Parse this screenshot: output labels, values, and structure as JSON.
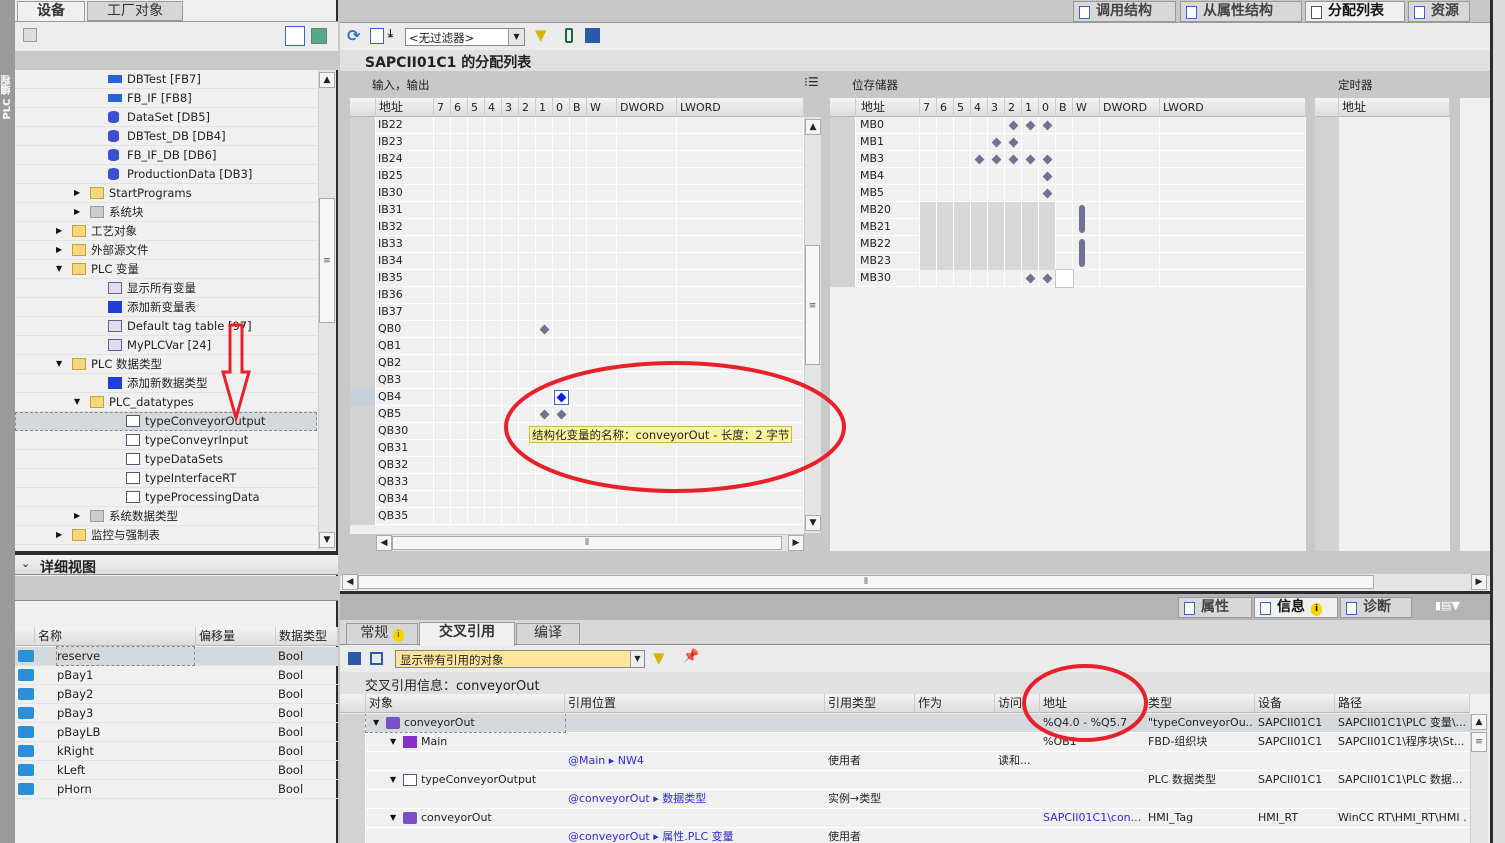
{
  "side_strip": "PLC 编程",
  "project_tree": {
    "tabs": [
      "设备",
      "工厂对象"
    ],
    "items": [
      {
        "label": "DBTest [FB7]",
        "level": 3,
        "icon": "fb-icon"
      },
      {
        "label": "FB_IF [FB8]",
        "level": 3,
        "icon": "fb-icon"
      },
      {
        "label": "DataSet [DB5]",
        "level": 3,
        "icon": "db-icon"
      },
      {
        "label": "DBTest_DB [DB4]",
        "level": 3,
        "icon": "db-icon"
      },
      {
        "label": "FB_IF_DB [DB6]",
        "level": 3,
        "icon": "db-icon"
      },
      {
        "label": "ProductionData [DB3]",
        "level": 3,
        "icon": "db-icon"
      },
      {
        "label": "StartPrograms",
        "level": 2,
        "icon": "folder-icon",
        "expand": "collapsed"
      },
      {
        "label": "系统块",
        "level": 2,
        "icon": "gray-folder-icon",
        "expand": "collapsed"
      },
      {
        "label": "工艺对象",
        "level": 1,
        "icon": "folder-icon",
        "expand": "collapsed"
      },
      {
        "label": "外部源文件",
        "level": 1,
        "icon": "folder-icon",
        "expand": "collapsed"
      },
      {
        "label": "PLC 变量",
        "level": 1,
        "icon": "folder-icon",
        "expand": "expanded"
      },
      {
        "label": "显示所有变量",
        "level": 3,
        "icon": "tag-table-icon"
      },
      {
        "label": "添加新变量表",
        "level": 3,
        "icon": "add-new-icon"
      },
      {
        "label": "Default tag table [97]",
        "level": 3,
        "icon": "tag-table-icon"
      },
      {
        "label": "MyPLCVar [24]",
        "level": 3,
        "icon": "tag-table-icon"
      },
      {
        "label": "PLC 数据类型",
        "level": 1,
        "icon": "folder-icon",
        "expand": "expanded"
      },
      {
        "label": "添加新数据类型",
        "level": 3,
        "icon": "add-new-icon"
      },
      {
        "label": "PLC_datatypes",
        "level": 2,
        "icon": "folder-icon",
        "expand": "expanded"
      },
      {
        "label": "typeConveyorOutput",
        "level": 4,
        "icon": "udt-icon",
        "selected": true
      },
      {
        "label": "typeConveyrInput",
        "level": 4,
        "icon": "udt-icon"
      },
      {
        "label": "typeDataSets",
        "level": 4,
        "icon": "udt-icon"
      },
      {
        "label": "typeInterfaceRT",
        "level": 4,
        "icon": "udt-icon"
      },
      {
        "label": "typeProcessingData",
        "level": 4,
        "icon": "udt-icon"
      },
      {
        "label": "系统数据类型",
        "level": 2,
        "icon": "gray-folder-icon",
        "expand": "collapsed"
      },
      {
        "label": "监控与强制表",
        "level": 1,
        "icon": "folder-icon",
        "expand": "collapsed"
      }
    ]
  },
  "detail_view": {
    "title": "详细视图",
    "columns": [
      "名称",
      "偏移量",
      "数据类型"
    ],
    "rows": [
      {
        "name": "reserve",
        "offset": "",
        "type": "Bool",
        "selected": true
      },
      {
        "name": "pBay1",
        "offset": "",
        "type": "Bool"
      },
      {
        "name": "pBay2",
        "offset": "",
        "type": "Bool"
      },
      {
        "name": "pBay3",
        "offset": "",
        "type": "Bool"
      },
      {
        "name": "pBayLB",
        "offset": "",
        "type": "Bool"
      },
      {
        "name": "kRight",
        "offset": "",
        "type": "Bool"
      },
      {
        "name": "kLeft",
        "offset": "",
        "type": "Bool"
      },
      {
        "name": "pHorn",
        "offset": "",
        "type": "Bool"
      }
    ]
  },
  "editor": {
    "top_tabs": [
      "调用结构",
      "从属性结构",
      "分配列表",
      "资源"
    ],
    "active_tab": "分配列表",
    "filter_value": "<无过滤器>",
    "title": "SAPCII01C1 的分配列表",
    "sections": {
      "io": "输入，输出",
      "memory": "位存储器",
      "timers": "定时器"
    },
    "bit_columns": [
      "地址",
      "7",
      "6",
      "5",
      "4",
      "3",
      "2",
      "1",
      "0",
      "B",
      "W",
      "DWORD",
      "LWORD"
    ],
    "timer_column": "地址",
    "io_rows": [
      {
        "addr": "IB22",
        "bits": []
      },
      {
        "addr": "IB23",
        "bits": []
      },
      {
        "addr": "IB24",
        "bits": []
      },
      {
        "addr": "IB25",
        "bits": []
      },
      {
        "addr": "IB30",
        "bits": []
      },
      {
        "addr": "IB31",
        "bits": []
      },
      {
        "addr": "IB32",
        "bits": []
      },
      {
        "addr": "IB33",
        "bits": []
      },
      {
        "addr": "IB34",
        "bits": []
      },
      {
        "addr": "IB35",
        "bits": []
      },
      {
        "addr": "IB36",
        "bits": []
      },
      {
        "addr": "IB37",
        "bits": []
      },
      {
        "addr": "QB0",
        "bits": [
          1
        ]
      },
      {
        "addr": "QB1",
        "bits": []
      },
      {
        "addr": "QB2",
        "bits": []
      },
      {
        "addr": "QB3",
        "bits": []
      },
      {
        "addr": "QB4",
        "bits": [
          0
        ],
        "selected": true
      },
      {
        "addr": "QB5",
        "bits": [
          1,
          0
        ]
      },
      {
        "addr": "QB30",
        "bits": []
      },
      {
        "addr": "QB31",
        "bits": []
      },
      {
        "addr": "QB32",
        "bits": []
      },
      {
        "addr": "QB33",
        "bits": []
      },
      {
        "addr": "QB34",
        "bits": []
      },
      {
        "addr": "QB35",
        "bits": []
      }
    ],
    "mem_rows": [
      {
        "addr": "MB0",
        "bits": [
          2,
          1,
          0
        ]
      },
      {
        "addr": "MB1",
        "bits": [
          3,
          2
        ],
        "has_icon": true
      },
      {
        "addr": "MB3",
        "bits": [
          4,
          3,
          2,
          1,
          0
        ]
      },
      {
        "addr": "MB4",
        "bits": [
          0
        ]
      },
      {
        "addr": "MB5",
        "bits": [
          0
        ]
      },
      {
        "addr": "MB20",
        "bits": [],
        "word": true
      },
      {
        "addr": "MB21",
        "bits": [],
        "word": true
      },
      {
        "addr": "MB22",
        "bits": [],
        "word": true
      },
      {
        "addr": "MB23",
        "bits": [],
        "word": true
      },
      {
        "addr": "MB30",
        "bits": [
          1,
          0
        ],
        "byte_box": true
      }
    ],
    "tooltip": "结构化变量的名称：conveyorOut - 长度：2 字节"
  },
  "inspector": {
    "tabs": [
      "属性",
      "信息",
      "诊断"
    ],
    "subtabs": [
      "常规",
      "交叉引用",
      "编译"
    ],
    "active_subtab": "交叉引用",
    "filter_value": "显示带有引用的对象",
    "title": "交叉引用信息：conveyorOut",
    "columns": [
      "对象",
      "引用位置",
      "引用类型",
      "作为",
      "访问",
      "地址",
      "类型",
      "设备",
      "路径"
    ],
    "rows": [
      {
        "level": 0,
        "icon": "tag-icon",
        "object": "conveyorOut",
        "location": "",
        "reftype": "",
        "as": "",
        "access": "",
        "address": "%Q4.0 - %Q5.7",
        "type": "\"typeConveyorOu...",
        "device": "SAPCII01C1",
        "path": "SAPCII01C1\\PLC 变量\\...",
        "selected": true
      },
      {
        "level": 1,
        "icon": "block-icon",
        "object": "Main",
        "location": "",
        "reftype": "",
        "as": "",
        "access": "",
        "address": "%OB1",
        "type": "FBD-组织块",
        "device": "SAPCII01C1",
        "path": "SAPCII01C1\\程序块\\St..."
      },
      {
        "level": 2,
        "object": "",
        "location": "@Main ▸ NW4",
        "reftype": "使用者",
        "as": "",
        "access": "读和...",
        "address": "",
        "type": "",
        "device": "",
        "path": ""
      },
      {
        "level": 1,
        "icon": "udt-icon",
        "object": "typeConveyorOutput",
        "location": "",
        "reftype": "",
        "as": "",
        "access": "",
        "address": "",
        "type": "PLC 数据类型",
        "device": "SAPCII01C1",
        "path": "SAPCII01C1\\PLC 数据..."
      },
      {
        "level": 2,
        "object": "",
        "location": "@conveyorOut ▸ 数据类型",
        "reftype": "实例→类型",
        "as": "",
        "access": "",
        "address": "",
        "type": "",
        "device": "",
        "path": ""
      },
      {
        "level": 1,
        "icon": "tag-icon",
        "object": "conveyorOut",
        "location": "",
        "reftype": "",
        "as": "",
        "access": "",
        "address": "SAPCII01C1\\con...",
        "type": "HMI_Tag",
        "device": "HMI_RT",
        "path": "WinCC RT\\HMI_RT\\HMI ..."
      },
      {
        "level": 2,
        "object": "",
        "location": "@conveyorOut ▸ 属性.PLC 变量",
        "reftype": "使用者",
        "as": "",
        "access": "",
        "address": "",
        "type": "",
        "device": "",
        "path": ""
      }
    ]
  },
  "colors": {
    "annotation": "#e8202a",
    "selection": "#d4d9de",
    "tooltip_bg": "#fbf59a",
    "marker": "#6f7391",
    "marker_selected": "#0b1ee8",
    "link": "#2b2bd8"
  }
}
